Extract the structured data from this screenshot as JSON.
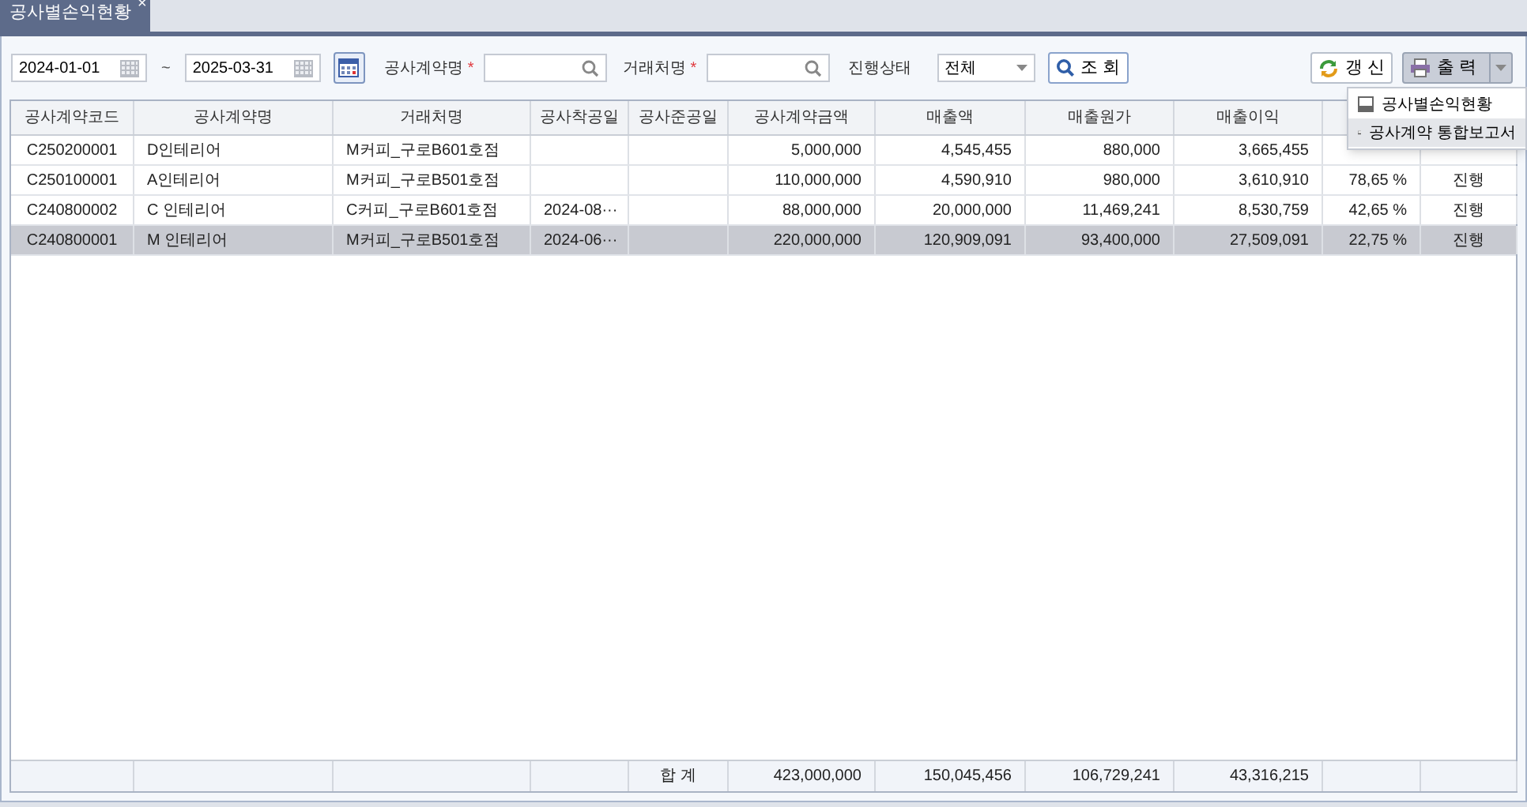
{
  "tab": {
    "label": "공사별손익현황",
    "close": "×",
    "selected": true
  },
  "filters": {
    "date_from": "2024-01-01",
    "tilde": "~",
    "date_to": "2025-03-31",
    "contract": {
      "label": "공사계약명",
      "mark": "*"
    },
    "client": {
      "label": "거래처명",
      "mark": "*"
    },
    "status": {
      "label": "진행상태",
      "value": "전체"
    }
  },
  "buttons": {
    "search": "조 회",
    "refresh": "갱 신",
    "print": "출 력"
  },
  "print_menu": [
    {
      "label": "공사별손익현황",
      "selected": false
    },
    {
      "label": "공사계약 통합보고서",
      "selected": true
    }
  ],
  "table": {
    "columns": [
      "공사계약코드",
      "공사계약명",
      "거래처명",
      "공사착공일",
      "공사준공일",
      "공사계약금액",
      "매출액",
      "매출원가",
      "매출이익"
    ],
    "rows": [
      {
        "selected": false,
        "code": "C250200001",
        "contract": "D인테리어",
        "client": "M커피_구로B601호점",
        "amount": "5,000,000",
        "sales": "4,545,455",
        "cost": "880,000",
        "profit": "3,665,455"
      },
      {
        "selected": false,
        "code": "C250100001",
        "contract": "A인테리어",
        "client": "M커피_구로B501호점",
        "amount": "110,000,000",
        "sales": "4,590,910",
        "cost": "980,000",
        "profit": "3,610,910",
        "rate": "78,65 %",
        "status": "진행"
      },
      {
        "selected": false,
        "code": "C240800002",
        "contract": "C 인테리어",
        "client": "C커피_구로B601호점",
        "start": "2024-08···",
        "amount": "88,000,000",
        "sales": "20,000,000",
        "cost": "11,469,241",
        "profit": "8,530,759",
        "rate": "42,65 %",
        "status": "진행"
      },
      {
        "selected": true,
        "code": "C240800001",
        "contract": "M 인테리어",
        "client": "M커피_구로B501호점",
        "start": "2024-06···",
        "amount": "220,000,000",
        "sales": "120,909,091",
        "cost": "93,400,000",
        "profit": "27,509,091",
        "rate": "22,75 %",
        "status": "진행"
      }
    ],
    "totals": {
      "label": "합 계",
      "amount": "423,000,000",
      "sales": "150,045,456",
      "cost": "106,729,241",
      "profit": "43,316,215"
    }
  }
}
